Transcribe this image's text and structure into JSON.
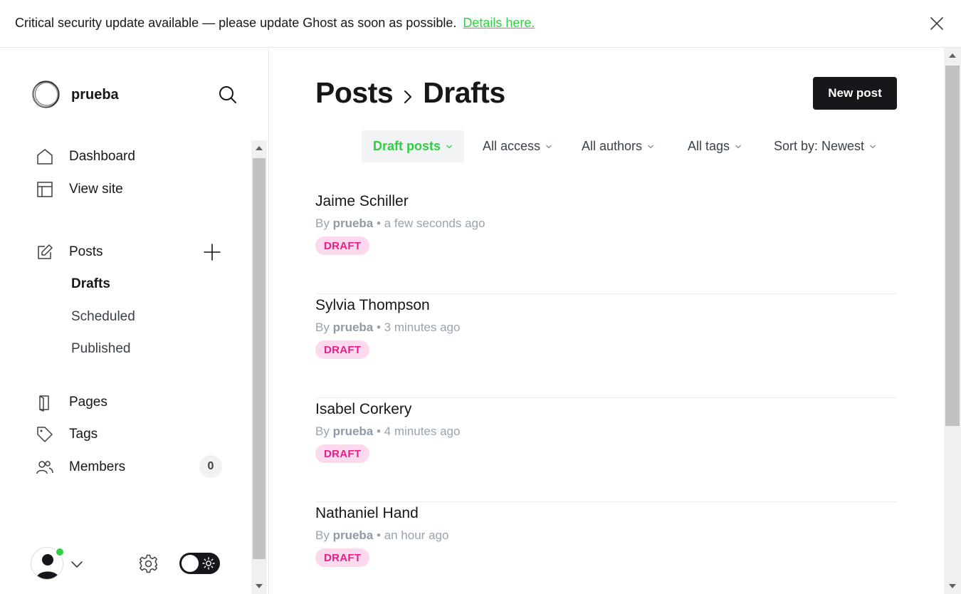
{
  "banner": {
    "message": "Critical security update available — please update Ghost as soon as possible.",
    "link_label": "Details here.",
    "close_icon": "close-icon"
  },
  "sidebar": {
    "site_name": "prueba",
    "nav": [
      {
        "label": "Dashboard",
        "icon": "home-icon"
      },
      {
        "label": "View site",
        "icon": "layout-icon"
      },
      {
        "label": "Posts",
        "icon": "edit-icon"
      },
      {
        "label": "Pages",
        "icon": "page-icon"
      },
      {
        "label": "Tags",
        "icon": "tag-icon"
      },
      {
        "label": "Members",
        "icon": "members-icon"
      }
    ],
    "post_subnav": [
      {
        "label": "Drafts",
        "active": true
      },
      {
        "label": "Scheduled",
        "active": false
      },
      {
        "label": "Published",
        "active": false
      }
    ],
    "members_count": "0"
  },
  "header": {
    "section": "Posts",
    "current": "Drafts",
    "new_post_label": "New post"
  },
  "filters": [
    {
      "label": "Draft posts",
      "active": true
    },
    {
      "label": "All access",
      "active": false
    },
    {
      "label": "All authors",
      "active": false
    },
    {
      "label": "All tags",
      "active": false
    },
    {
      "label": "Sort by: Newest",
      "active": false
    }
  ],
  "posts": [
    {
      "title": "Jaime Schiller",
      "by": "By",
      "author": "prueba",
      "time": "• a few seconds ago",
      "status": "DRAFT"
    },
    {
      "title": "Sylvia Thompson",
      "by": "By",
      "author": "prueba",
      "time": "• 3 minutes ago",
      "status": "DRAFT"
    },
    {
      "title": "Isabel Corkery",
      "by": "By",
      "author": "prueba",
      "time": "• 4 minutes ago",
      "status": "DRAFT"
    },
    {
      "title": "Nathaniel Hand",
      "by": "By",
      "author": "prueba",
      "time": "• an hour ago",
      "status": "DRAFT"
    }
  ],
  "colors": {
    "accent_green": "#30cf43",
    "draft_pink_text": "#e91e89",
    "draft_pink_bg": "#fdd9ee",
    "primary_dark": "#15171a"
  }
}
